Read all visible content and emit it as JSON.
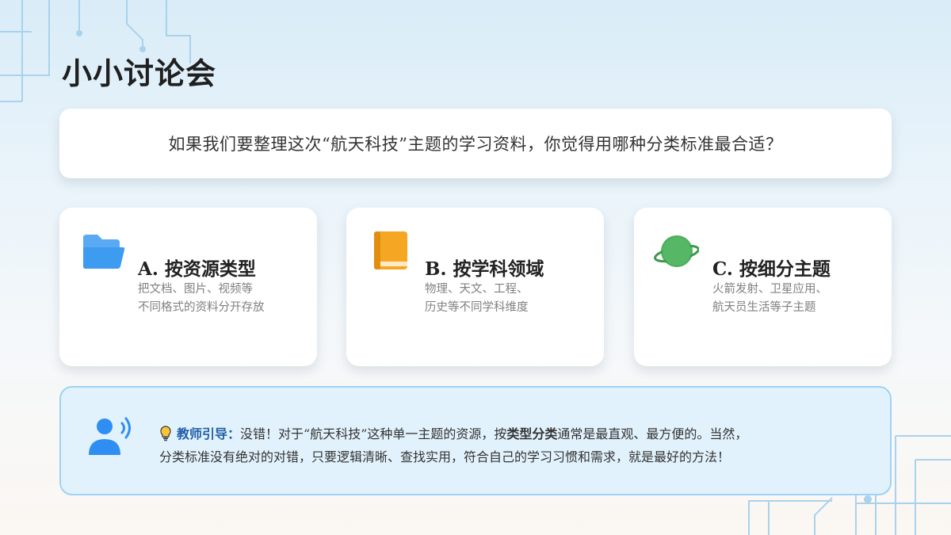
{
  "slide": {
    "title": "小小讨论会",
    "question": "如果我们要整理这次“航天科技”主题的学习资料，你觉得用哪种分类标准最合适？"
  },
  "options": [
    {
      "title": "A. 按资源类型",
      "desc_line1": "把文档、图片、视频等",
      "desc_line2": "不同格式的资料分开存放",
      "icon": "folder-icon",
      "color": "#3d9bf0"
    },
    {
      "title": "B. 按学科领域",
      "desc_line1": "物理、天文、工程、",
      "desc_line2": "历史等不同学科维度",
      "icon": "book-icon",
      "color": "#f5a623"
    },
    {
      "title": "C. 按细分主题",
      "desc_line1": "火箭发射、卫星应用、",
      "desc_line2": "航天员生活等子主题",
      "icon": "planet-icon",
      "color": "#4cae5c"
    }
  ],
  "guide": {
    "icon": "teacher-speaking-icon",
    "bulb_icon": "lightbulb-icon",
    "label": "教师引导：",
    "text_part1": "没错！对于“航天科技”这种单一主题的资源，按",
    "emphasis": "类型分类",
    "text_part2": "通常是最直观、最方便的。当然，",
    "text_line2": "分类标准没有绝对的对错，只要逻辑清晰、查找实用，符合自己的学习习惯和需求，就是最好的方法！",
    "label_color": "#1f5ea8",
    "icon_color": "#2f8ef2"
  }
}
